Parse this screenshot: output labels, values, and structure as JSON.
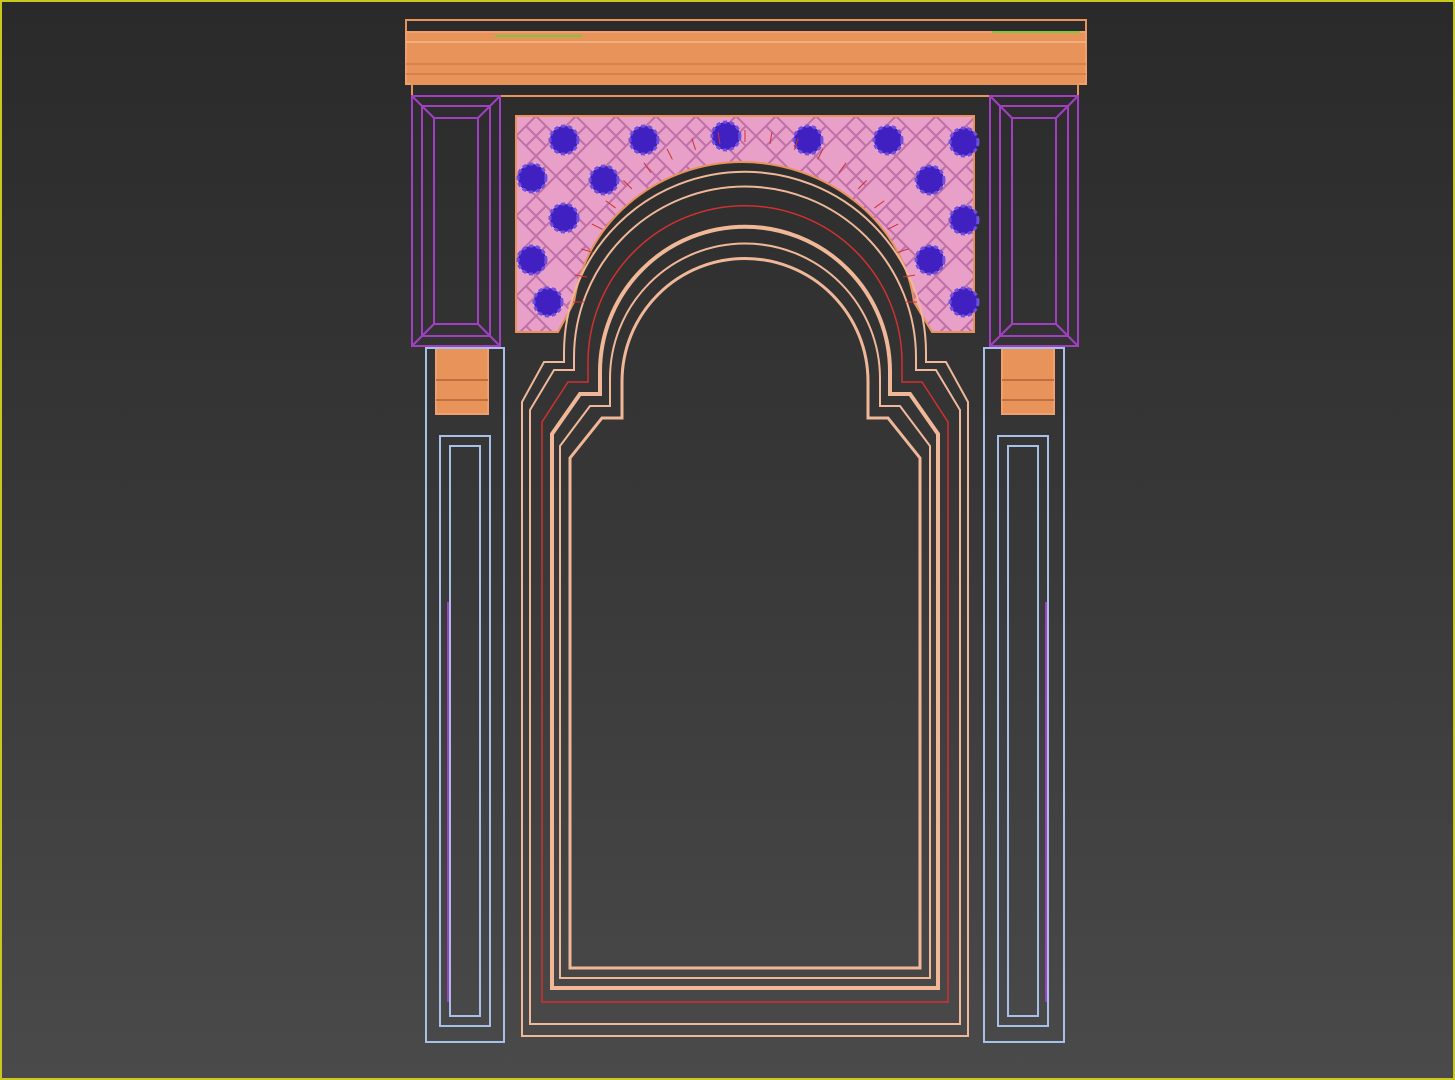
{
  "viewport": {
    "label": "",
    "active_border_color": "#c8c81e",
    "background_top": "#2a2a2a",
    "background_bottom": "#4a4a4a"
  },
  "model": {
    "subject": "arched-doorway-wireframe",
    "colors": {
      "cornice": "#e8935a",
      "side_panels": "#a040c0",
      "lattice": "#e8a0c8",
      "rosettes": "#4020c0",
      "columns": "#a8c0e8",
      "arch_molding": "#f0b898",
      "inner_arch": "#d03030",
      "top_accent": "#7fc640"
    }
  }
}
